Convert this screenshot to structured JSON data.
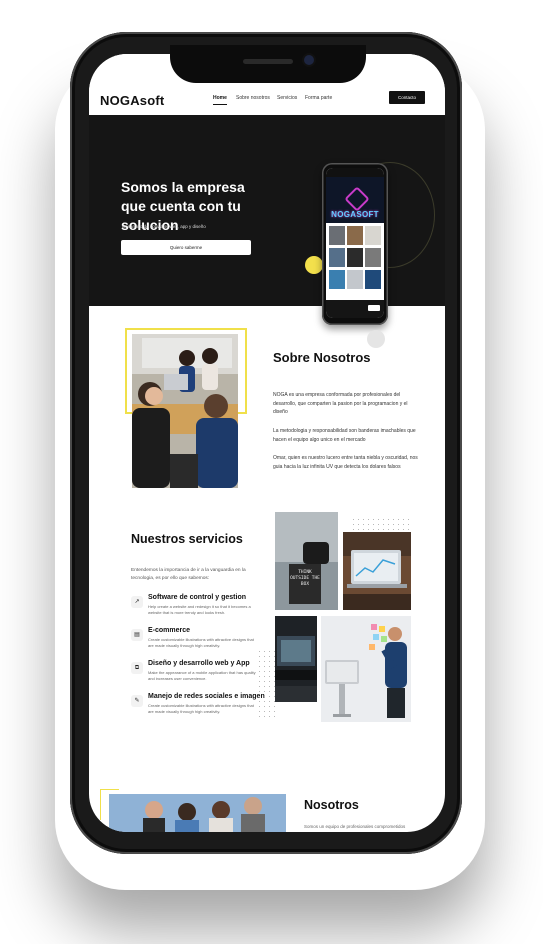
{
  "nav": {
    "logo": "NOGAsoft",
    "links": [
      "Home",
      "Sobre nosotros",
      "Servicios",
      "Forma parte"
    ],
    "contact": "Contacto"
  },
  "hero": {
    "title": "Somos la empresa que cuenta con tu solucion",
    "subtitle": "Desarrollo de software, web, app y diseño",
    "button": "Quiero saberme",
    "mockup_logo": "NOGASOFT"
  },
  "about": {
    "title": "Sobre Nosotros",
    "paragraphs": [
      "NOGA es una empresa conformada por profesionales del desarrollo, que comparten la pasion por la programacion y el diseño",
      "La metodologia y responsabilidad son banderas imachables que hacen el equipo algo unico en el mercado",
      "Omar, quien es nuestro lucero entre tanta niebla y oscuridad, nos guia hacia la luz infinita UV que detecta los dolares falsos"
    ]
  },
  "services": {
    "title": "Nuestros servicios",
    "intro": "Entendemos la importancia de ir a la vanguardia en la tecnologia, es por ello que sabemos:",
    "items": [
      {
        "icon": "chart-icon",
        "glyph": "↗",
        "name": "Software de control y gestion",
        "desc": "Help create a website and redesign it so that it becomes a website that is more trendy and looks fresh."
      },
      {
        "icon": "clipboard-icon",
        "glyph": "▤",
        "name": "E-commerce",
        "desc": "Create customizable illustrations with attractive designs that are made visually through high creativity."
      },
      {
        "icon": "devices-icon",
        "glyph": "⧉",
        "name": "Diseño y desarrollo web y App",
        "desc": "Make the appearance of a mobile application that has quality and increases user convenience."
      },
      {
        "icon": "chat-icon",
        "glyph": "✎",
        "name": "Manejo de redes sociales e imagen",
        "desc": "Create customizable illustrations with attractive designs that are made visually through high creativity."
      }
    ]
  },
  "photos": {
    "sign_text": "THINK OUTSIDE THE BOX"
  },
  "team": {
    "title": "Nosotros",
    "text": "Somos un equipo de profesionales comprometidos"
  }
}
